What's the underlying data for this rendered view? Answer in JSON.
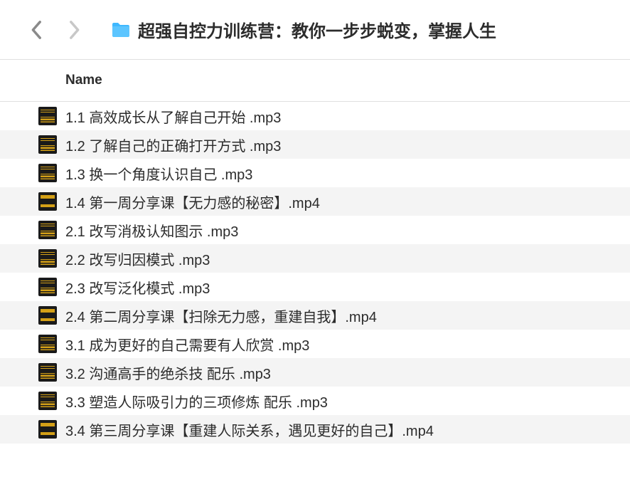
{
  "toolbar": {
    "folder_name": "超强自控力训练营：教你一步步蜕变，掌握人生"
  },
  "columns": {
    "name": "Name"
  },
  "files": [
    {
      "name": "1.1 高效成长从了解自己开始 .mp3",
      "type": "mp3"
    },
    {
      "name": "1.2 了解自己的正确打开方式 .mp3",
      "type": "mp3"
    },
    {
      "name": "1.3 换一个角度认识自己 .mp3",
      "type": "mp3"
    },
    {
      "name": "1.4 第一周分享课【无力感的秘密】.mp4",
      "type": "mp4"
    },
    {
      "name": "2.1 改写消极认知图示 .mp3",
      "type": "mp3"
    },
    {
      "name": "2.2 改写归因模式 .mp3",
      "type": "mp3"
    },
    {
      "name": "2.3 改写泛化模式 .mp3",
      "type": "mp3"
    },
    {
      "name": "2.4 第二周分享课【扫除无力感，重建自我】.mp4",
      "type": "mp4"
    },
    {
      "name": "3.1 成为更好的自己需要有人欣赏 .mp3",
      "type": "mp3"
    },
    {
      "name": "3.2 沟通高手的绝杀技 配乐 .mp3",
      "type": "mp3"
    },
    {
      "name": "3.3 塑造人际吸引力的三项修炼 配乐 .mp3",
      "type": "mp3"
    },
    {
      "name": "3.4 第三周分享课【重建人际关系，遇见更好的自己】.mp4",
      "type": "mp4"
    }
  ]
}
